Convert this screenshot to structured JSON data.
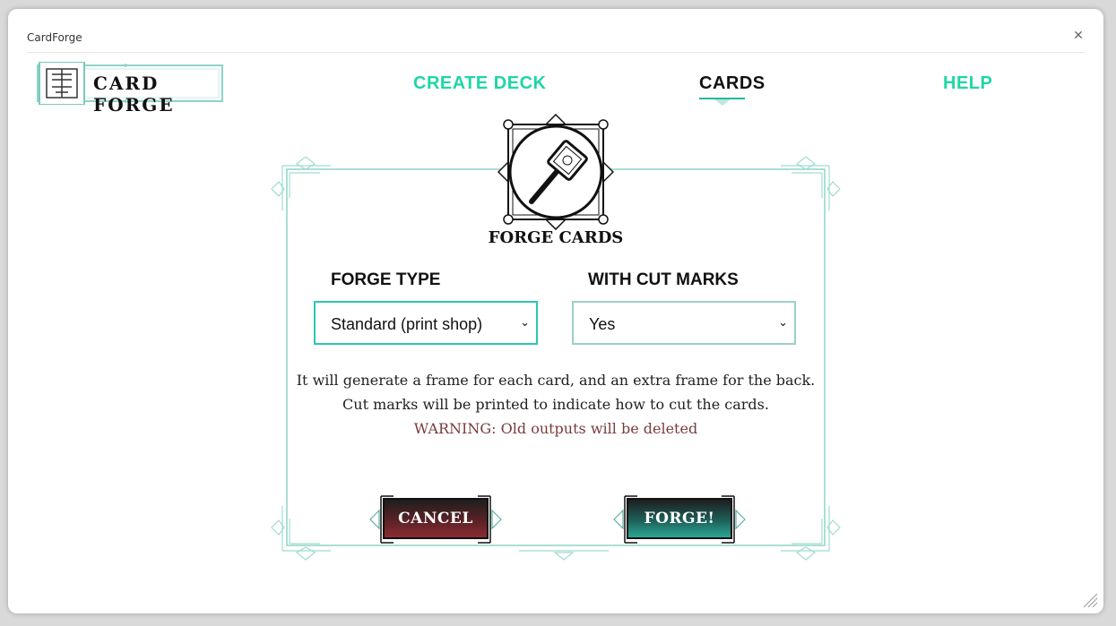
{
  "app": {
    "title": "CardForge"
  },
  "logo": {
    "text": "CARD FORGE"
  },
  "nav": {
    "create_deck": "CREATE DECK",
    "cards": "CARDS",
    "help": "HELP"
  },
  "panel": {
    "title": "FORGE CARDS",
    "forge_type": {
      "label": "FORGE TYPE",
      "value": "Standard (print shop)"
    },
    "cut_marks": {
      "label": "WITH CUT MARKS",
      "value": "Yes"
    },
    "description_1": "It will generate a frame for each card, and an extra frame for the back.",
    "description_2": "Cut marks will be printed to indicate how to cut the cards.",
    "warning": "WARNING: Old outputs will be deleted"
  },
  "buttons": {
    "cancel": "CANCEL",
    "forge": "FORGE!"
  },
  "colors": {
    "accent": "#1ed6a6",
    "frame": "#8fd3c7",
    "cancel": "#8a2b32",
    "forge": "#2ba894",
    "warning": "#7a3b3b"
  }
}
